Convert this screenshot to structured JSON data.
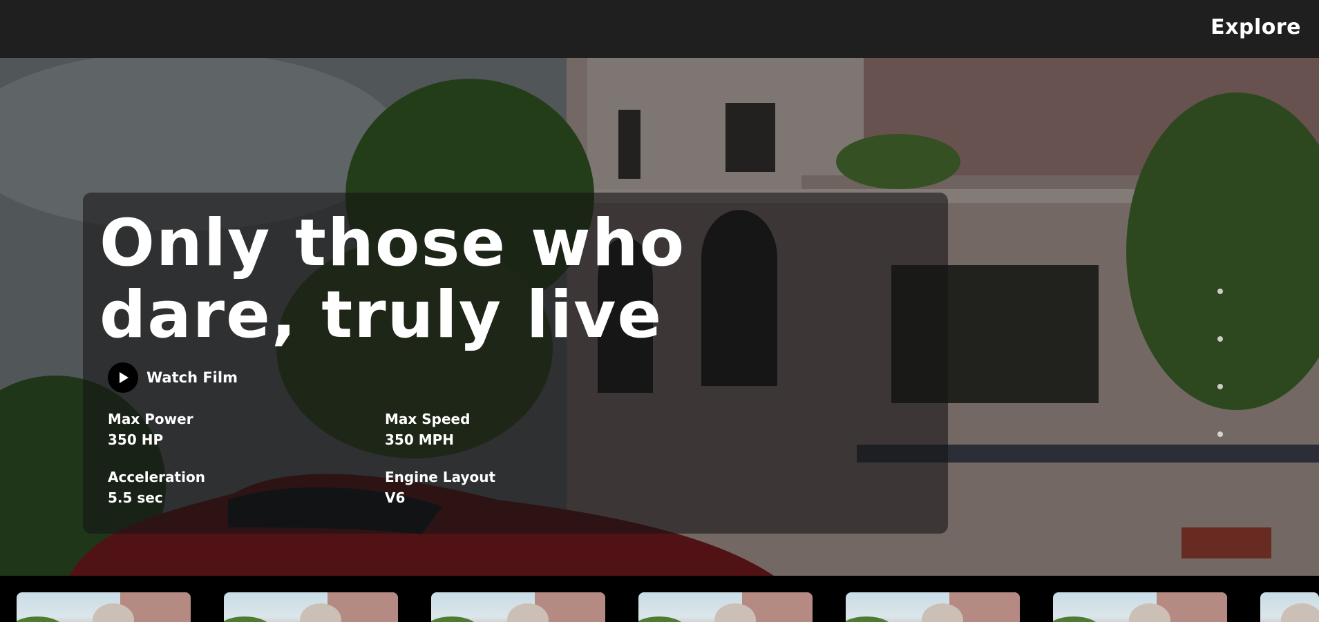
{
  "nav": {
    "explore_label": "Explore"
  },
  "hero": {
    "headline_line1": "Only those who",
    "headline_line2": "dare, truly live",
    "watch_label": "Watch Film",
    "specs": [
      {
        "label": "Max Power",
        "value": "350 HP"
      },
      {
        "label": "Max Speed",
        "value": "350 MPH"
      },
      {
        "label": "Acceleration",
        "value": "5.5 sec"
      },
      {
        "label": "Engine Layout",
        "value": "V6"
      }
    ],
    "slide_dot_count": 4
  },
  "thumbnail_count": 7,
  "colors": {
    "topbar": "#1f1f1f",
    "card": "rgba(20,20,20,0.58)",
    "car_red": "#8c1f26"
  },
  "icons": {
    "play": "play-icon"
  }
}
